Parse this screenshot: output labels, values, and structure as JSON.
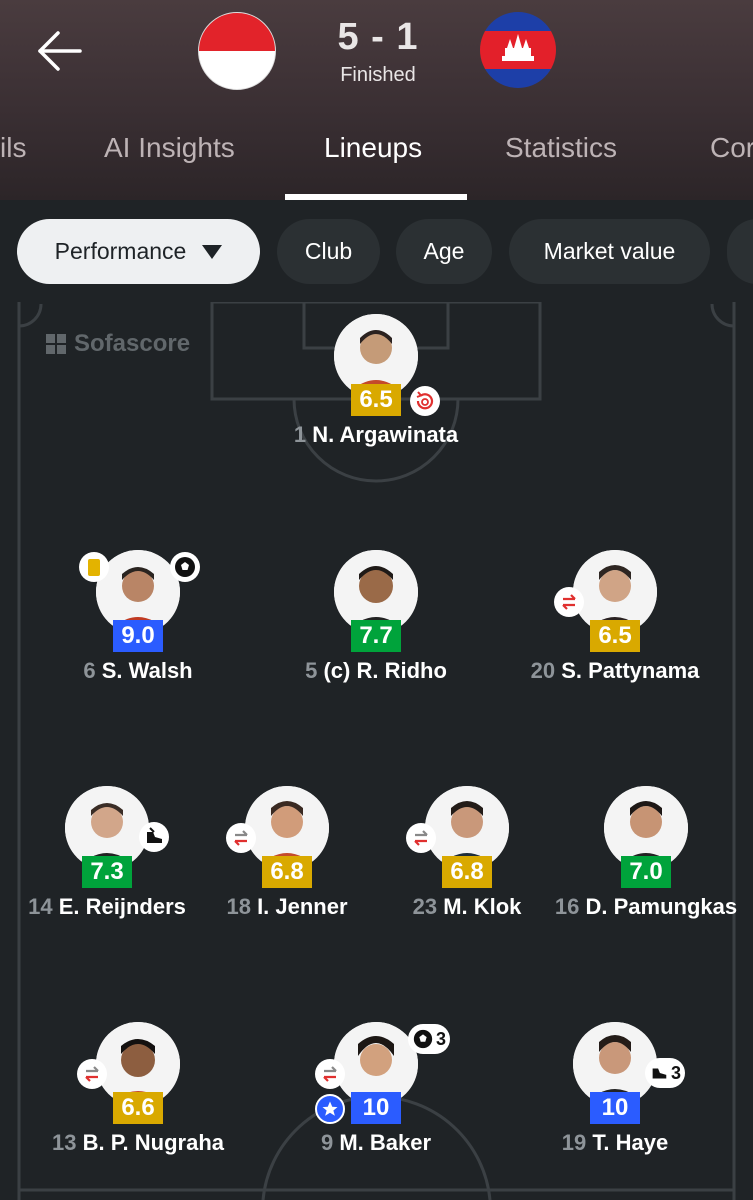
{
  "header": {
    "score": "5 - 1",
    "status": "Finished",
    "home_team_flag": "indonesia-flag",
    "away_team_flag": "cambodia-flag"
  },
  "tabs": [
    {
      "label": "ils"
    },
    {
      "label": "AI Insights"
    },
    {
      "label": "Lineups",
      "active": true
    },
    {
      "label": "Statistics"
    },
    {
      "label": "Cor"
    }
  ],
  "filters": [
    {
      "label": "Performance",
      "active": true
    },
    {
      "label": "Club"
    },
    {
      "label": "Age"
    },
    {
      "label": "Market value"
    }
  ],
  "watermark": "Sofascore",
  "players": [
    {
      "number": "1",
      "name": "N. Argawinata",
      "rating": "6.5",
      "rating_color": "#d9a900",
      "events": [
        "substitution-in-icon"
      ]
    },
    {
      "number": "6",
      "name": "S. Walsh",
      "rating": "9.0",
      "rating_color": "#2b5cff",
      "events": [
        "yellow-card-icon",
        "ball-icon"
      ]
    },
    {
      "number": "5",
      "name": "(c) R. Ridho",
      "rating": "7.7",
      "rating_color": "#00a33b",
      "events": []
    },
    {
      "number": "20",
      "name": "S. Pattynama",
      "rating": "6.5",
      "rating_color": "#d9a900",
      "events": [
        "substitution-icon"
      ]
    },
    {
      "number": "14",
      "name": "E. Reijnders",
      "rating": "7.3",
      "rating_color": "#00a33b",
      "events": [
        "assist-boot-icon"
      ]
    },
    {
      "number": "18",
      "name": "I. Jenner",
      "rating": "6.8",
      "rating_color": "#d9a900",
      "events": [
        "substitution-icon"
      ]
    },
    {
      "number": "23",
      "name": "M. Klok",
      "rating": "6.8",
      "rating_color": "#d9a900",
      "events": [
        "substitution-icon"
      ]
    },
    {
      "number": "16",
      "name": "D. Pamungkas",
      "rating": "7.0",
      "rating_color": "#00a33b",
      "events": []
    },
    {
      "number": "13",
      "name": "B. P. Nugraha",
      "rating": "6.6",
      "rating_color": "#d9a900",
      "events": [
        "substitution-icon"
      ]
    },
    {
      "number": "9",
      "name": "M. Baker",
      "rating": "10",
      "rating_color": "#2b5cff",
      "events": [
        "substitution-icon",
        "goal-icon",
        "star-icon"
      ],
      "goal_count": "3"
    },
    {
      "number": "19",
      "name": "T. Haye",
      "rating": "10",
      "rating_color": "#2b5cff",
      "events": [
        "assist-boot-icon"
      ],
      "assist_count": "3"
    }
  ]
}
